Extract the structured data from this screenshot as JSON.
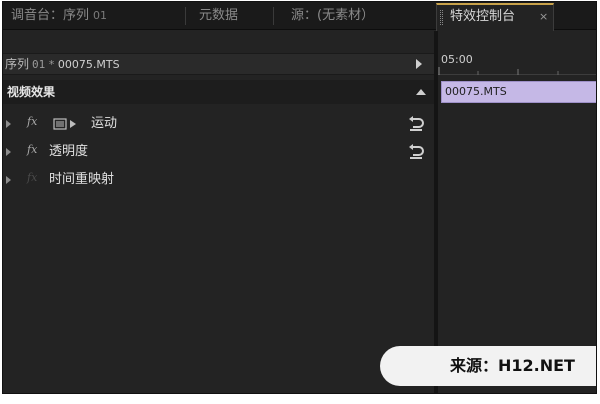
{
  "tabs": [
    {
      "label": "调音台：序列",
      "suffix": "01"
    },
    {
      "label": "元数据",
      "suffix": ""
    },
    {
      "label": "源：(无素材）",
      "suffix": ""
    }
  ],
  "active_tab": {
    "label": "特效控制台",
    "close_glyph": "×"
  },
  "sequence_header": {
    "label": "序列",
    "sequence_num": "01",
    "separator": "*",
    "clip_name": "00075.MTS"
  },
  "section": {
    "label": "视频效果"
  },
  "effects": [
    {
      "fx": "fx",
      "name": "运动",
      "has_reset": true,
      "has_motion_icon": true,
      "fx_dimmed": false
    },
    {
      "fx": "fx",
      "name": "透明度",
      "has_reset": true,
      "has_motion_icon": false,
      "fx_dimmed": false
    },
    {
      "fx": "fx",
      "name": "时间重映射",
      "has_reset": false,
      "has_motion_icon": false,
      "fx_dimmed": true
    }
  ],
  "timeline": {
    "time_label": "05:00",
    "clip_name": "00075.MTS",
    "clip_color": "#c5b8e6"
  },
  "watermark": {
    "text": "来源：H12.NET"
  },
  "colors": {
    "panel_bg": "#232323",
    "active_tab_accent": "#c8a24a",
    "clip_bar": "#c5b8e6"
  }
}
